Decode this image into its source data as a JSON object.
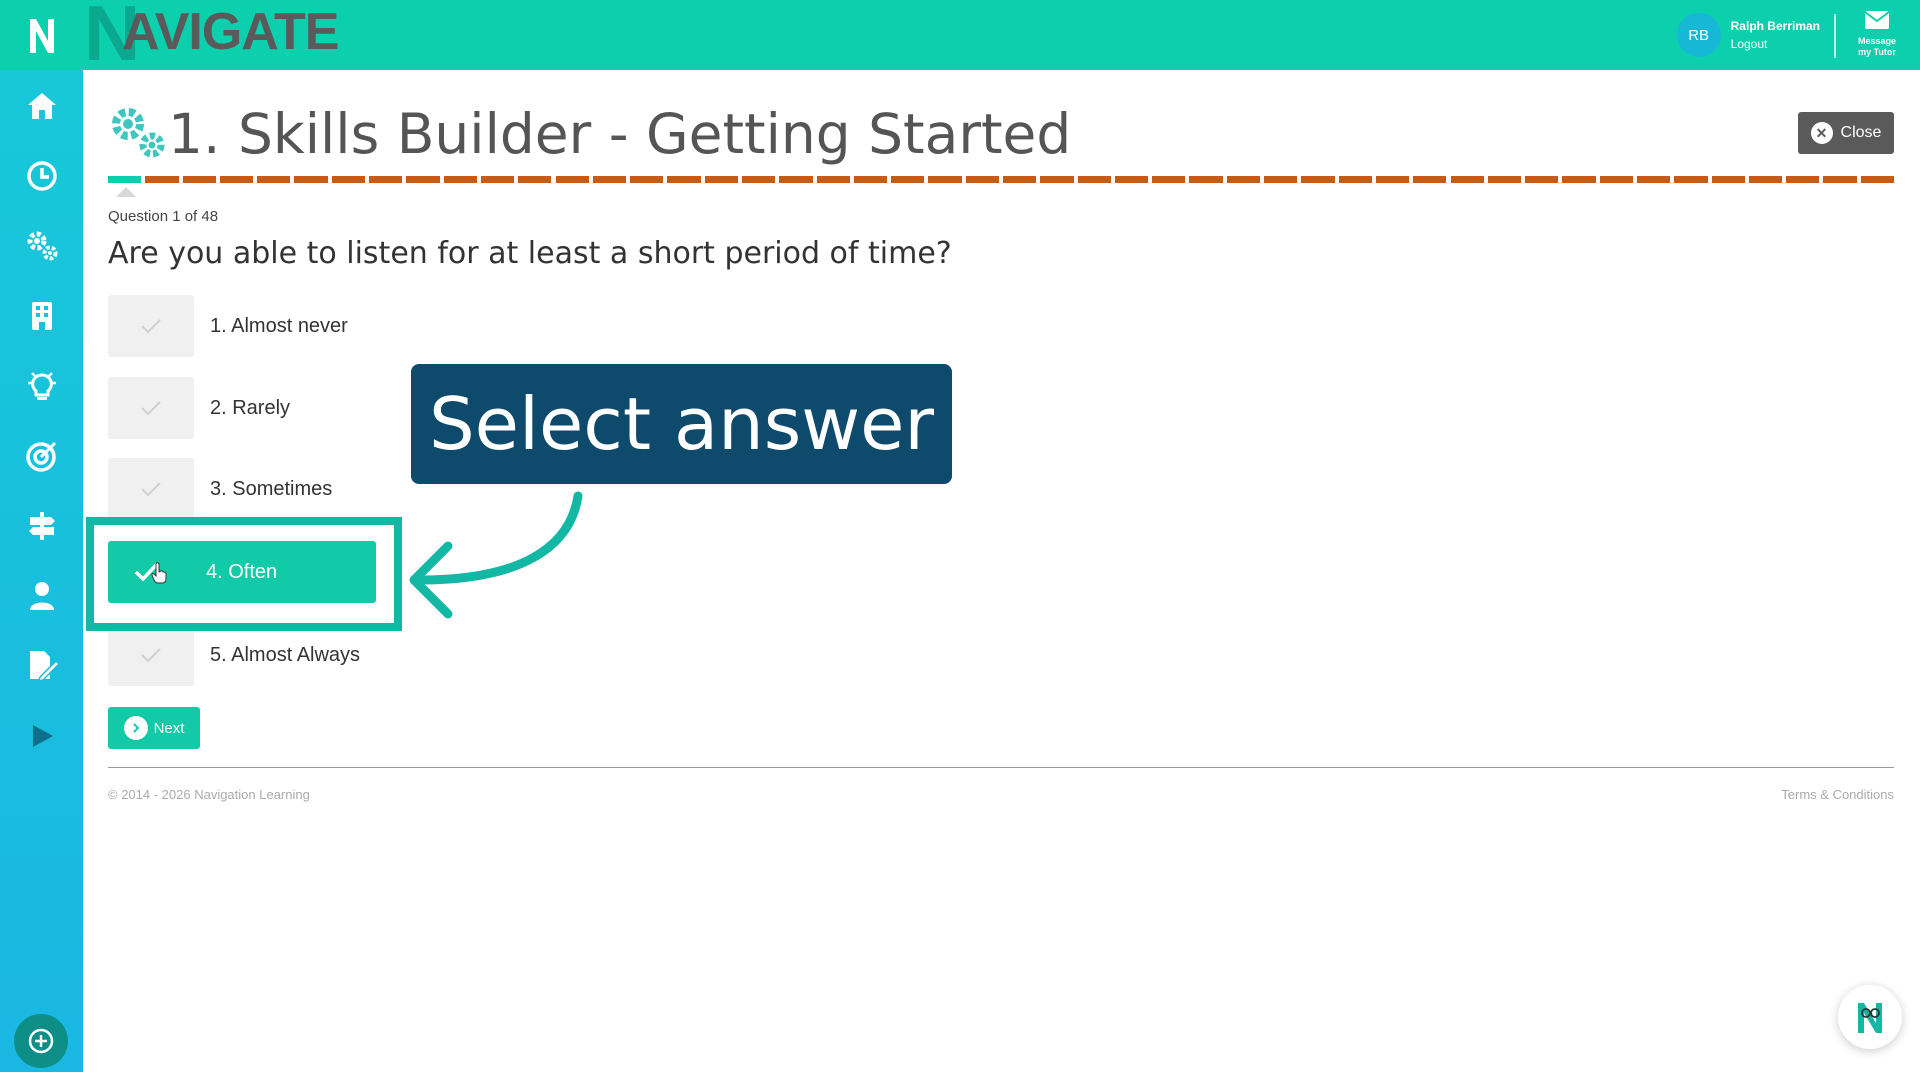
{
  "brand": {
    "logo_letter": "N",
    "name": "AVIGATE"
  },
  "user": {
    "initials": "RB",
    "name": "Ralph Berriman",
    "logout": "Logout"
  },
  "message_tutor": {
    "line1": "Message",
    "line2": "my Tutor"
  },
  "sidebar": {
    "items": [
      {
        "icon": "home-icon"
      },
      {
        "icon": "clock-icon"
      },
      {
        "icon": "gears-icon"
      },
      {
        "icon": "building-icon"
      },
      {
        "icon": "lightbulb-icon"
      },
      {
        "icon": "target-icon"
      },
      {
        "icon": "signpost-icon"
      },
      {
        "icon": "person-icon"
      },
      {
        "icon": "edit-document-icon"
      },
      {
        "icon": "play-icon"
      }
    ],
    "bottom_icon": "plus-circle-icon"
  },
  "page": {
    "title": "1. Skills Builder - Getting Started",
    "close_label": "Close"
  },
  "quiz": {
    "question_count": "Question 1 of 48",
    "current": 1,
    "total": 48,
    "question": "Are you able to listen for at least a short period of time?",
    "options": [
      {
        "label": "1. Almost never",
        "selected": false
      },
      {
        "label": "2. Rarely",
        "selected": false
      },
      {
        "label": "3. Sometimes",
        "selected": false
      },
      {
        "label": "4. Often",
        "selected": true
      },
      {
        "label": "5. Almost Always",
        "selected": false
      }
    ],
    "next_label": "Next"
  },
  "callout": {
    "text": "Select answer"
  },
  "footer": {
    "copyright": "© 2014 - 2026 Navigation Learning",
    "terms": "Terms & Conditions"
  },
  "colors": {
    "topbar": "#0ccfae",
    "progress_done": "#0ccfae",
    "progress_todo": "#c95a12",
    "callout_bg": "#0d4a6b",
    "selected": "#12c9a8"
  }
}
